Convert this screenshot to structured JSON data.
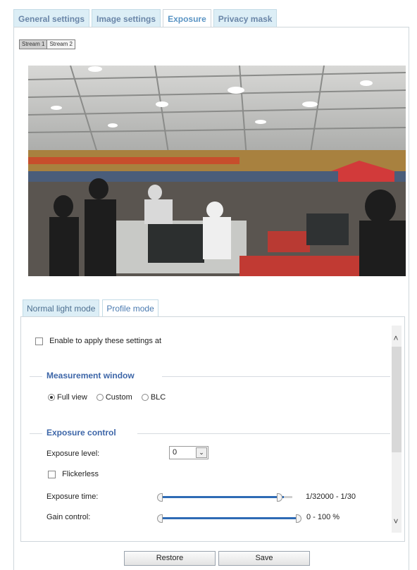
{
  "tabs": [
    "General settings",
    "Image settings",
    "Exposure",
    "Privacy mask"
  ],
  "active_tab": "Exposure",
  "stream_selector": [
    "Stream 1",
    "Stream 2"
  ],
  "mode_tabs": [
    "Normal light mode",
    "Profile mode"
  ],
  "panel": {
    "enable_label": "Enable to apply these settings at",
    "measurement": {
      "title": "Measurement window",
      "options": [
        "Full view",
        "Custom",
        "BLC"
      ],
      "selected": "Full view"
    },
    "exposure": {
      "title": "Exposure control",
      "level_label": "Exposure level:",
      "level_value": "0",
      "flickerless_label": "Flickerless",
      "time_label": "Exposure time:",
      "time_range": "1/32000 - 1/30",
      "time_slider": {
        "min": 0,
        "max": 1
      },
      "gain_label": "Gain control:",
      "gain_range": "0 - 100 %",
      "gain_slider": {
        "min": 0,
        "max": 1
      }
    }
  },
  "buttons": {
    "restore": "Restore",
    "save": "Save"
  }
}
